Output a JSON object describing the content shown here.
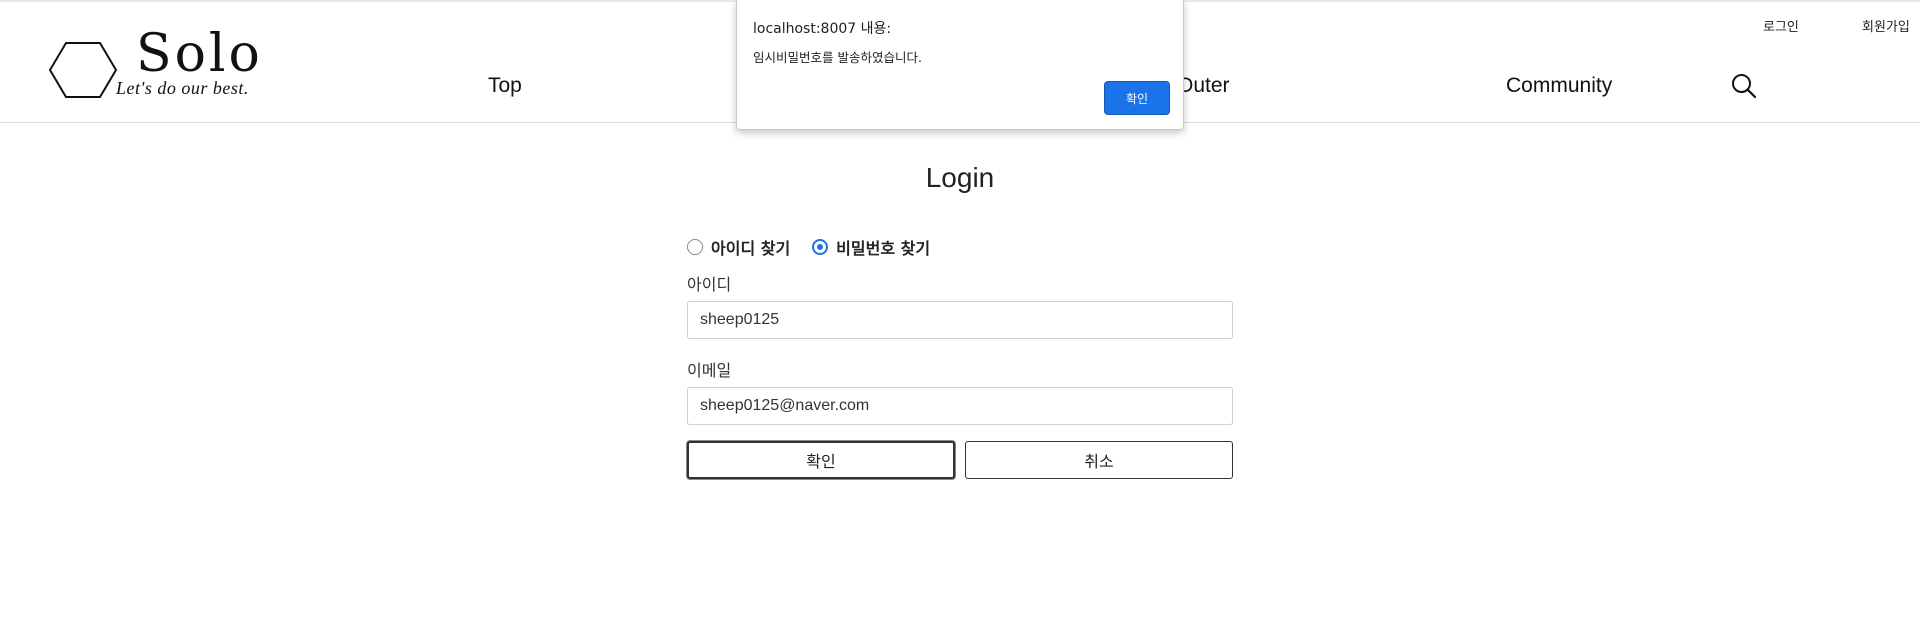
{
  "header": {
    "logo": {
      "title": "Solo",
      "tagline": "Let's do our best."
    },
    "nav": {
      "top": "Top",
      "outer": "Outer",
      "community": "Community"
    },
    "search_icon": "search-icon",
    "util": {
      "login": "로그인",
      "signup": "회원가입"
    }
  },
  "main": {
    "title": "Login",
    "find_options": [
      {
        "label": "아이디 찾기",
        "checked": false
      },
      {
        "label": "비밀번호 찾기",
        "checked": true
      }
    ],
    "id_field": {
      "label": "아이디",
      "value": "sheep0125"
    },
    "email_field": {
      "label": "이메일",
      "value": "sheep0125@naver.com"
    },
    "confirm_label": "확인",
    "cancel_label": "취소"
  },
  "dialog": {
    "title": "localhost:8007 내용:",
    "message": "임시비밀번호를 발송하였습니다.",
    "ok_label": "확인"
  },
  "colors": {
    "accent": "#1a73e8",
    "border": "#cfcfcf"
  }
}
